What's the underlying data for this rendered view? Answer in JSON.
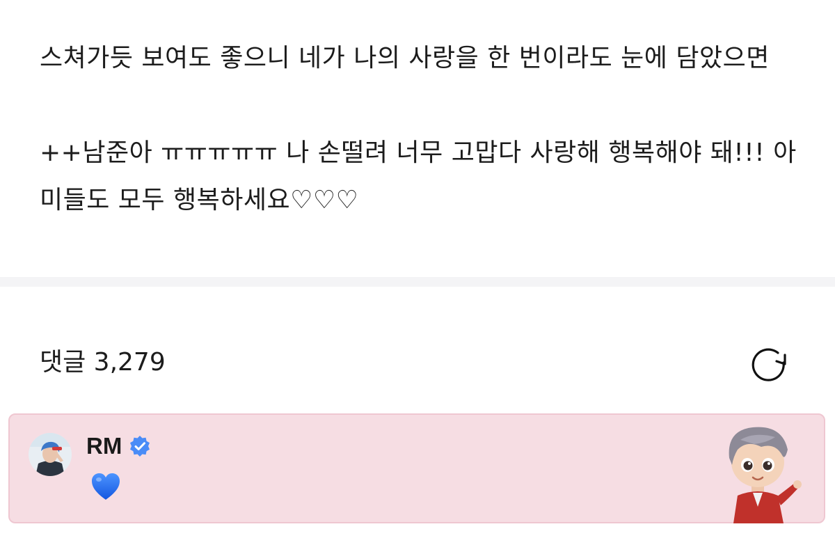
{
  "post": {
    "paragraph_1": "스쳐가듯 보여도 좋으니 네가 나의 사랑을 한 번이라도 눈에 담았으면",
    "paragraph_2": "++남준아 ㅠㅠㅠㅠㅠ 나 손떨려 너무 고맙다 사랑해 행복해야 돼!!! 아미들도 모두 행복하세요♡♡♡"
  },
  "comments": {
    "header_label": "댓글 3,279",
    "refresh_icon": "refresh-icon"
  },
  "comment": {
    "author": "RM",
    "verified_icon": "verified-badge-icon",
    "text": "💙",
    "text_glyph": "blue-heart-emoji",
    "sticker": "character-sticker"
  },
  "colors": {
    "card_background": "#f6dde3",
    "card_border": "#efc7d1",
    "verified_blue": "#4a8cf7",
    "heart_blue": "#1f6ef0"
  }
}
